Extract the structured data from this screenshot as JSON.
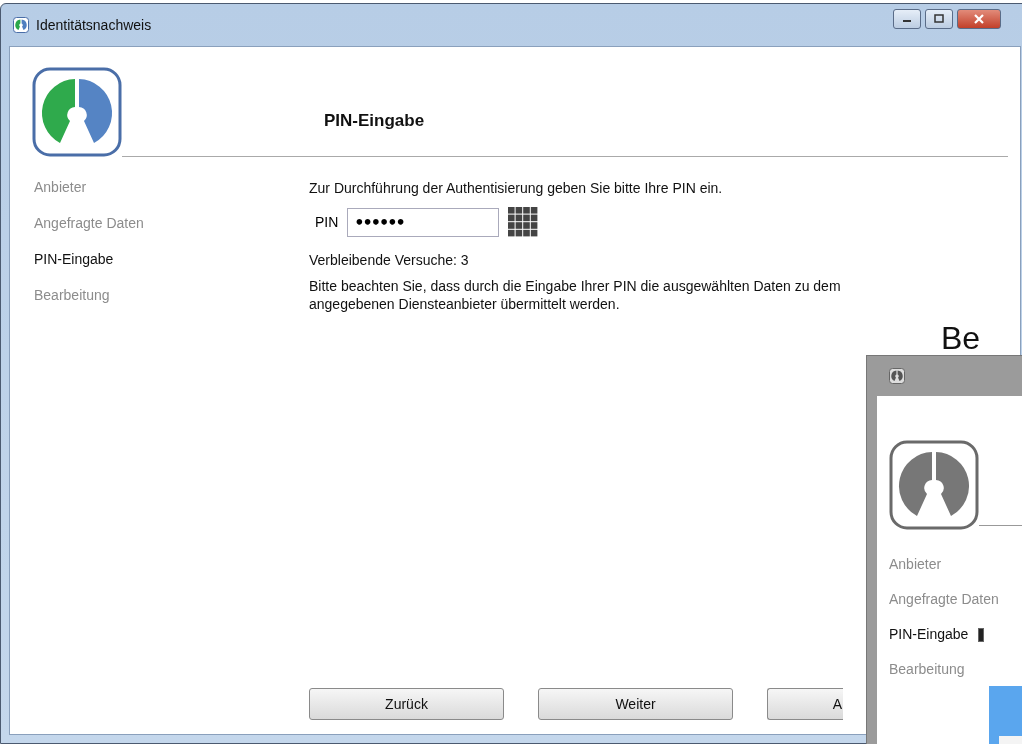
{
  "window": {
    "title": "Identitätsnachweis"
  },
  "steps": [
    {
      "label": "Anbieter",
      "selected": false
    },
    {
      "label": "Angefragte Daten",
      "selected": false
    },
    {
      "label": "PIN-Eingabe",
      "selected": true
    },
    {
      "label": "Bearbeitung",
      "selected": false
    }
  ],
  "page": {
    "heading": "PIN-Eingabe",
    "intro": "Zur Durchführung der Authentisierung geben Sie bitte Ihre PIN ein.",
    "pin": {
      "label": "PIN",
      "value": "••••••"
    },
    "remaining": "Verbleibende Versuche: 3",
    "notice": "Bitte beachten Sie, dass durch die Eingabe Ihrer PIN die ausgewählten Daten zu dem angegebenen Diensteanbieter übermittelt werden."
  },
  "buttons": [
    {
      "label": "Zurück"
    },
    {
      "label": "Weiter"
    },
    {
      "label": "A"
    }
  ],
  "overlay_text": "Be",
  "second_window": {
    "steps": [
      {
        "label": "Anbieter",
        "selected": false
      },
      {
        "label": "Angefragte Daten",
        "selected": false
      },
      {
        "label": "PIN-Eingabe",
        "selected": true
      },
      {
        "label": "Bearbeitung",
        "selected": false
      }
    ]
  }
}
